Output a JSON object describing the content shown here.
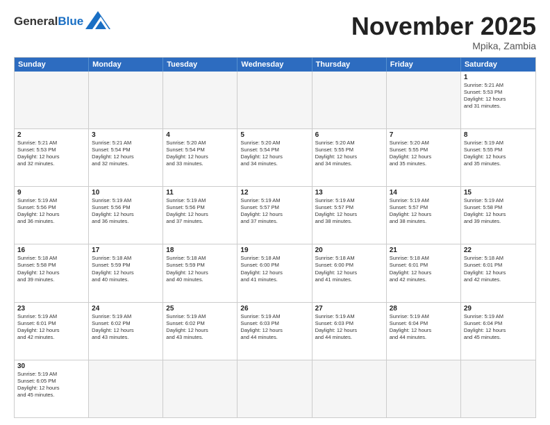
{
  "header": {
    "logo_general": "General",
    "logo_blue": "Blue",
    "month_title": "November 2025",
    "location": "Mpika, Zambia"
  },
  "day_headers": [
    "Sunday",
    "Monday",
    "Tuesday",
    "Wednesday",
    "Thursday",
    "Friday",
    "Saturday"
  ],
  "rows": [
    [
      {
        "day": "",
        "info": "",
        "empty": true
      },
      {
        "day": "",
        "info": "",
        "empty": true
      },
      {
        "day": "",
        "info": "",
        "empty": true
      },
      {
        "day": "",
        "info": "",
        "empty": true
      },
      {
        "day": "",
        "info": "",
        "empty": true
      },
      {
        "day": "",
        "info": "",
        "empty": true
      },
      {
        "day": "1",
        "info": "Sunrise: 5:21 AM\nSunset: 5:53 PM\nDaylight: 12 hours\nand 31 minutes.",
        "empty": false
      }
    ],
    [
      {
        "day": "2",
        "info": "Sunrise: 5:21 AM\nSunset: 5:53 PM\nDaylight: 12 hours\nand 32 minutes.",
        "empty": false
      },
      {
        "day": "3",
        "info": "Sunrise: 5:21 AM\nSunset: 5:54 PM\nDaylight: 12 hours\nand 32 minutes.",
        "empty": false
      },
      {
        "day": "4",
        "info": "Sunrise: 5:20 AM\nSunset: 5:54 PM\nDaylight: 12 hours\nand 33 minutes.",
        "empty": false
      },
      {
        "day": "5",
        "info": "Sunrise: 5:20 AM\nSunset: 5:54 PM\nDaylight: 12 hours\nand 34 minutes.",
        "empty": false
      },
      {
        "day": "6",
        "info": "Sunrise: 5:20 AM\nSunset: 5:55 PM\nDaylight: 12 hours\nand 34 minutes.",
        "empty": false
      },
      {
        "day": "7",
        "info": "Sunrise: 5:20 AM\nSunset: 5:55 PM\nDaylight: 12 hours\nand 35 minutes.",
        "empty": false
      },
      {
        "day": "8",
        "info": "Sunrise: 5:19 AM\nSunset: 5:55 PM\nDaylight: 12 hours\nand 35 minutes.",
        "empty": false
      }
    ],
    [
      {
        "day": "9",
        "info": "Sunrise: 5:19 AM\nSunset: 5:56 PM\nDaylight: 12 hours\nand 36 minutes.",
        "empty": false
      },
      {
        "day": "10",
        "info": "Sunrise: 5:19 AM\nSunset: 5:56 PM\nDaylight: 12 hours\nand 36 minutes.",
        "empty": false
      },
      {
        "day": "11",
        "info": "Sunrise: 5:19 AM\nSunset: 5:56 PM\nDaylight: 12 hours\nand 37 minutes.",
        "empty": false
      },
      {
        "day": "12",
        "info": "Sunrise: 5:19 AM\nSunset: 5:57 PM\nDaylight: 12 hours\nand 37 minutes.",
        "empty": false
      },
      {
        "day": "13",
        "info": "Sunrise: 5:19 AM\nSunset: 5:57 PM\nDaylight: 12 hours\nand 38 minutes.",
        "empty": false
      },
      {
        "day": "14",
        "info": "Sunrise: 5:19 AM\nSunset: 5:57 PM\nDaylight: 12 hours\nand 38 minutes.",
        "empty": false
      },
      {
        "day": "15",
        "info": "Sunrise: 5:19 AM\nSunset: 5:58 PM\nDaylight: 12 hours\nand 39 minutes.",
        "empty": false
      }
    ],
    [
      {
        "day": "16",
        "info": "Sunrise: 5:18 AM\nSunset: 5:58 PM\nDaylight: 12 hours\nand 39 minutes.",
        "empty": false
      },
      {
        "day": "17",
        "info": "Sunrise: 5:18 AM\nSunset: 5:59 PM\nDaylight: 12 hours\nand 40 minutes.",
        "empty": false
      },
      {
        "day": "18",
        "info": "Sunrise: 5:18 AM\nSunset: 5:59 PM\nDaylight: 12 hours\nand 40 minutes.",
        "empty": false
      },
      {
        "day": "19",
        "info": "Sunrise: 5:18 AM\nSunset: 6:00 PM\nDaylight: 12 hours\nand 41 minutes.",
        "empty": false
      },
      {
        "day": "20",
        "info": "Sunrise: 5:18 AM\nSunset: 6:00 PM\nDaylight: 12 hours\nand 41 minutes.",
        "empty": false
      },
      {
        "day": "21",
        "info": "Sunrise: 5:18 AM\nSunset: 6:01 PM\nDaylight: 12 hours\nand 42 minutes.",
        "empty": false
      },
      {
        "day": "22",
        "info": "Sunrise: 5:18 AM\nSunset: 6:01 PM\nDaylight: 12 hours\nand 42 minutes.",
        "empty": false
      }
    ],
    [
      {
        "day": "23",
        "info": "Sunrise: 5:19 AM\nSunset: 6:01 PM\nDaylight: 12 hours\nand 42 minutes.",
        "empty": false
      },
      {
        "day": "24",
        "info": "Sunrise: 5:19 AM\nSunset: 6:02 PM\nDaylight: 12 hours\nand 43 minutes.",
        "empty": false
      },
      {
        "day": "25",
        "info": "Sunrise: 5:19 AM\nSunset: 6:02 PM\nDaylight: 12 hours\nand 43 minutes.",
        "empty": false
      },
      {
        "day": "26",
        "info": "Sunrise: 5:19 AM\nSunset: 6:03 PM\nDaylight: 12 hours\nand 44 minutes.",
        "empty": false
      },
      {
        "day": "27",
        "info": "Sunrise: 5:19 AM\nSunset: 6:03 PM\nDaylight: 12 hours\nand 44 minutes.",
        "empty": false
      },
      {
        "day": "28",
        "info": "Sunrise: 5:19 AM\nSunset: 6:04 PM\nDaylight: 12 hours\nand 44 minutes.",
        "empty": false
      },
      {
        "day": "29",
        "info": "Sunrise: 5:19 AM\nSunset: 6:04 PM\nDaylight: 12 hours\nand 45 minutes.",
        "empty": false
      }
    ],
    [
      {
        "day": "30",
        "info": "Sunrise: 5:19 AM\nSunset: 6:05 PM\nDaylight: 12 hours\nand 45 minutes.",
        "empty": false
      },
      {
        "day": "",
        "info": "",
        "empty": true
      },
      {
        "day": "",
        "info": "",
        "empty": true
      },
      {
        "day": "",
        "info": "",
        "empty": true
      },
      {
        "day": "",
        "info": "",
        "empty": true
      },
      {
        "day": "",
        "info": "",
        "empty": true
      },
      {
        "day": "",
        "info": "",
        "empty": true
      }
    ]
  ]
}
